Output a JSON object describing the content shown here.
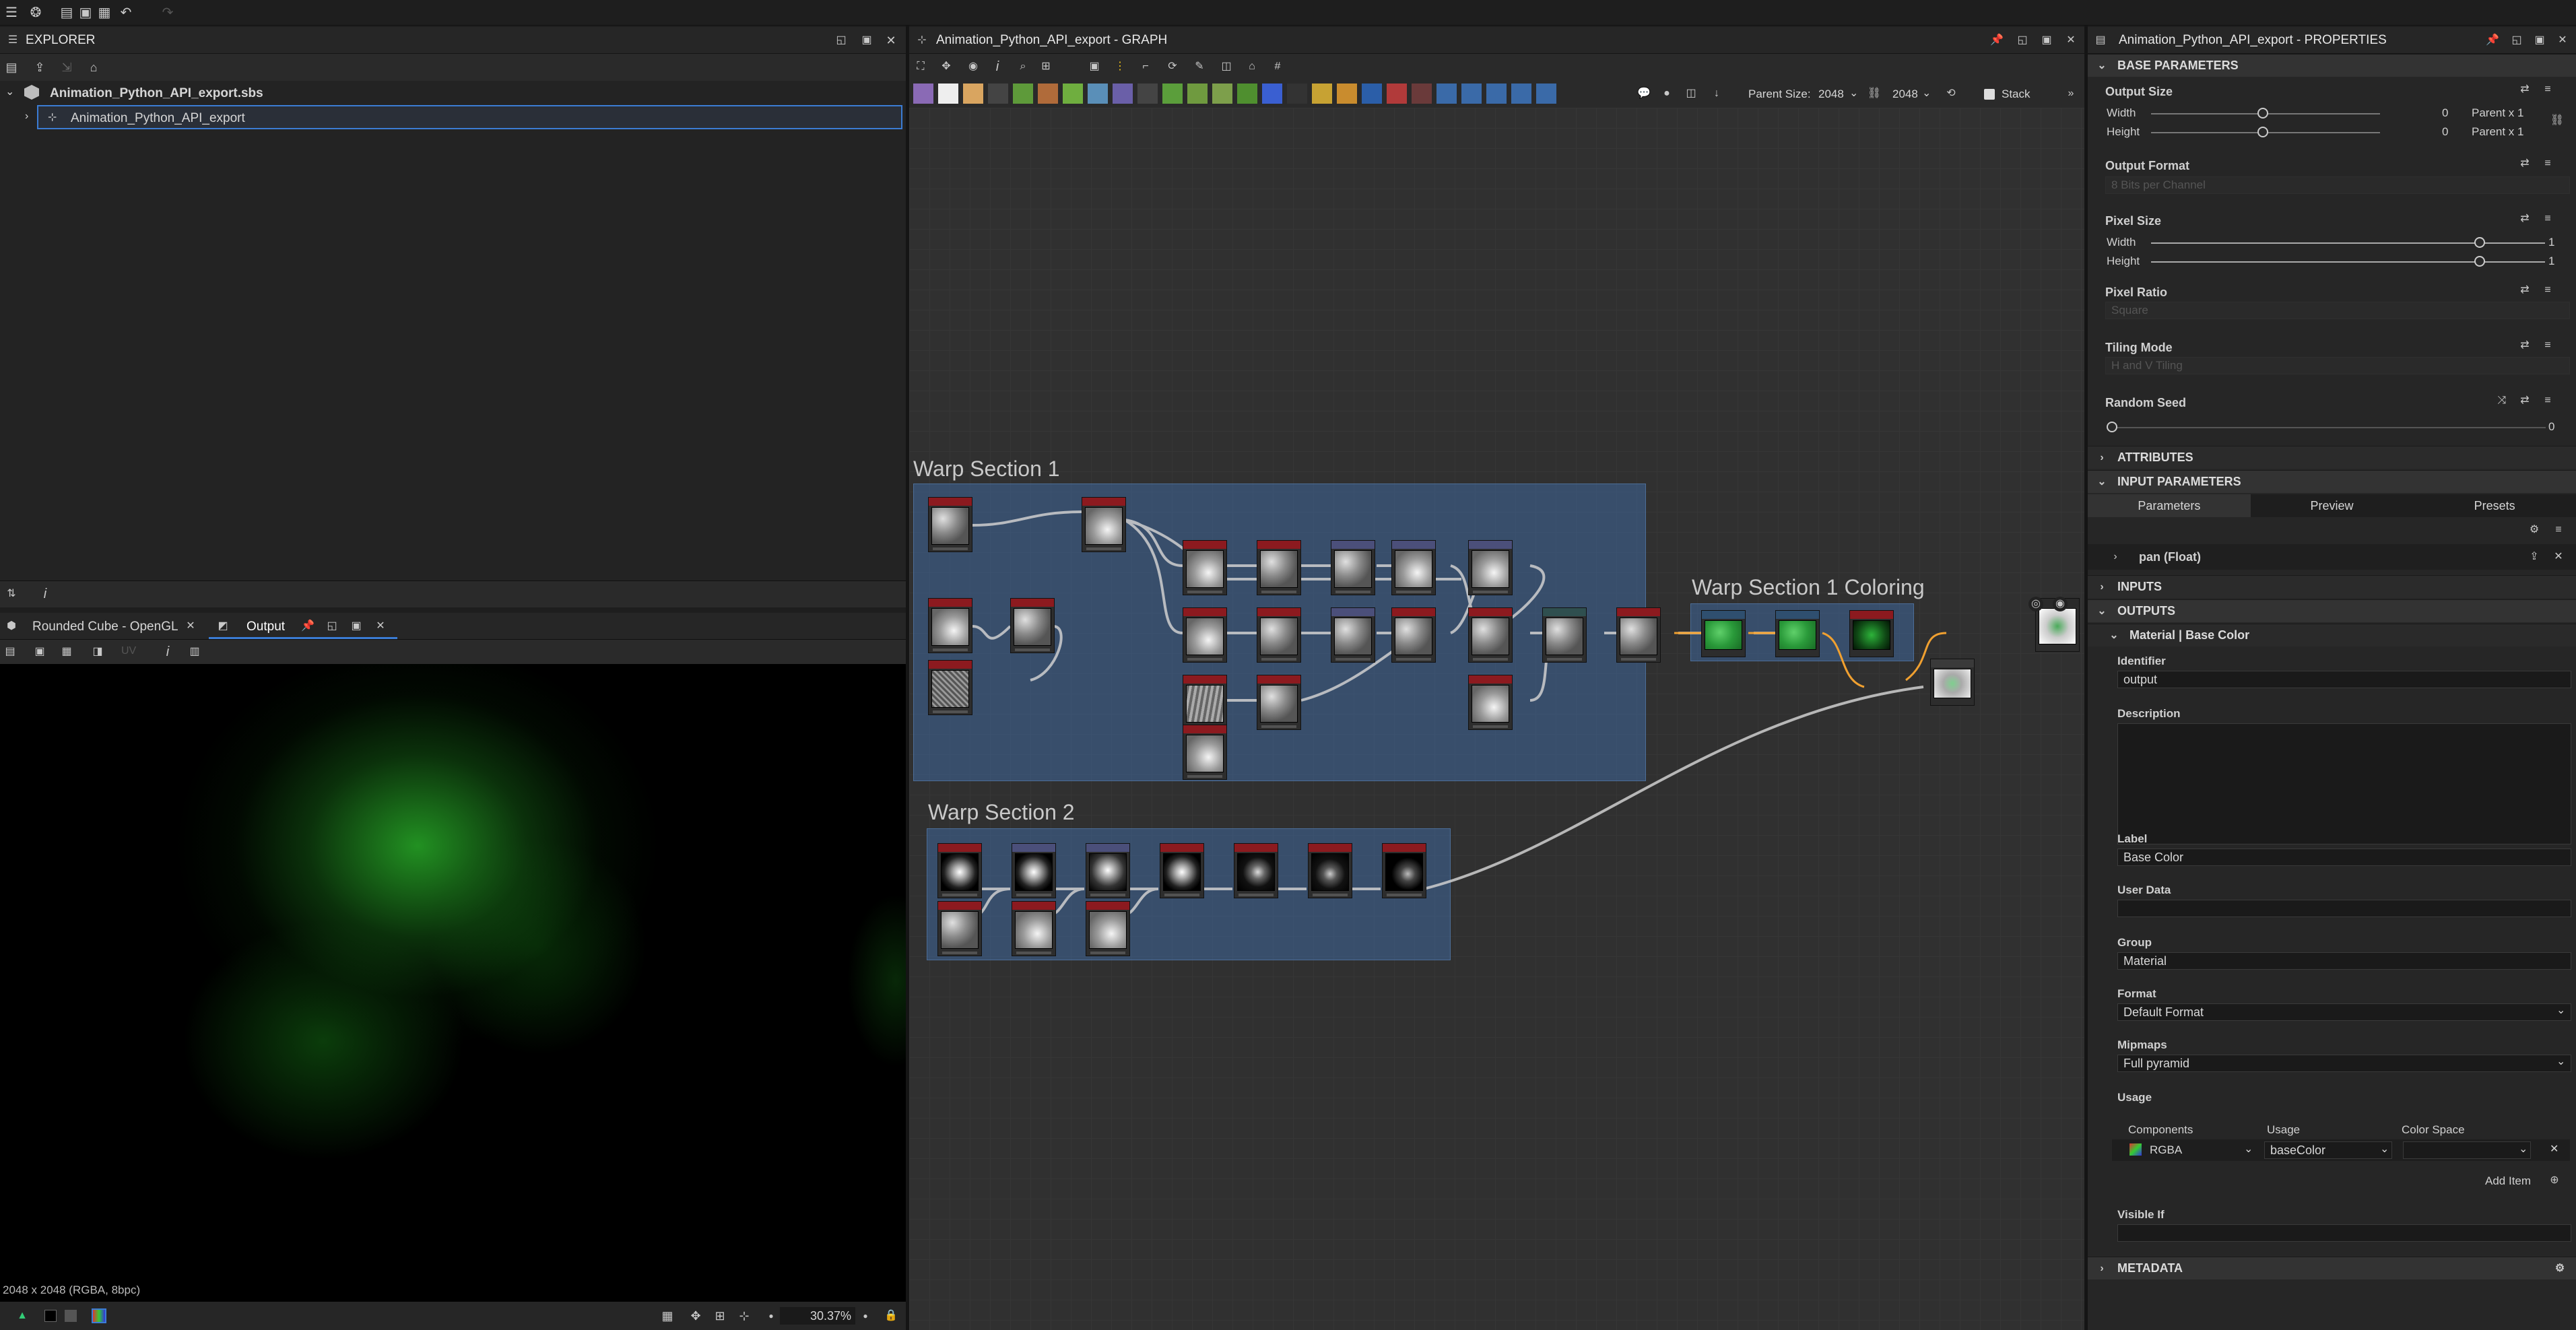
{
  "app": {
    "toolbar_icons": [
      "menu-icon",
      "globe-icon",
      "open-folder-icon",
      "save-icon",
      "undo-icon",
      "redo-icon"
    ]
  },
  "explorer": {
    "title": "EXPLORER",
    "package": "Animation_Python_API_export.sbs",
    "graph": "Animation_Python_API_export"
  },
  "viewport": {
    "tabs": [
      {
        "label": "Rounded Cube - OpenGL"
      },
      {
        "label": "Output"
      }
    ],
    "uv_label": "UV",
    "status": "2048 x 2048 (RGBA, 8bpc)",
    "zoom": "30.37%"
  },
  "graph": {
    "title": "Animation_Python_API_export - GRAPH",
    "parent_size_label": "Parent Size:",
    "parent_size": "2048",
    "size": "2048",
    "stack_label": "Stack",
    "frames": [
      {
        "title": "Warp Section 1"
      },
      {
        "title": "Warp Section 1 Coloring"
      },
      {
        "title": "Warp Section 2"
      }
    ]
  },
  "properties": {
    "title": "Animation_Python_API_export - PROPERTIES",
    "base_parameters": "BASE PARAMETERS",
    "output_size": {
      "label": "Output Size",
      "width_label": "Width",
      "height_label": "Height",
      "width_value": "0",
      "height_value": "0",
      "width_rel": "Parent x 1",
      "height_rel": "Parent x 1"
    },
    "output_format": {
      "label": "Output Format",
      "value": "8 Bits per Channel"
    },
    "pixel_size": {
      "label": "Pixel Size",
      "width_label": "Width",
      "height_label": "Height",
      "width_value": "1",
      "height_value": "1"
    },
    "pixel_ratio": {
      "label": "Pixel Ratio",
      "value": "Square"
    },
    "tiling_mode": {
      "label": "Tiling Mode",
      "value": "H and V Tiling"
    },
    "random_seed": {
      "label": "Random Seed",
      "value": "0"
    },
    "attributes": "ATTRIBUTES",
    "input_parameters": "INPUT PARAMETERS",
    "param_tabs": [
      "Parameters",
      "Preview",
      "Presets"
    ],
    "param_item": "pan (Float)",
    "inputs": "INPUTS",
    "outputs": "OUTPUTS",
    "output_item": "Material | Base Color",
    "identifier": {
      "label": "Identifier",
      "value": "output"
    },
    "description": {
      "label": "Description"
    },
    "label": {
      "label": "Label",
      "value": "Base Color"
    },
    "user_data": {
      "label": "User Data"
    },
    "group": {
      "label": "Group",
      "value": "Material"
    },
    "format": {
      "label": "Format",
      "value": "Default Format"
    },
    "mipmaps": {
      "label": "Mipmaps",
      "value": "Full pyramid"
    },
    "usage": {
      "label": "Usage",
      "col_components": "Components",
      "col_usage": "Usage",
      "col_colorspace": "Color Space",
      "components": "RGBA",
      "usage": "baseColor",
      "add_item": "Add Item"
    },
    "visible_if": {
      "label": "Visible If"
    },
    "metadata": "METADATA"
  }
}
